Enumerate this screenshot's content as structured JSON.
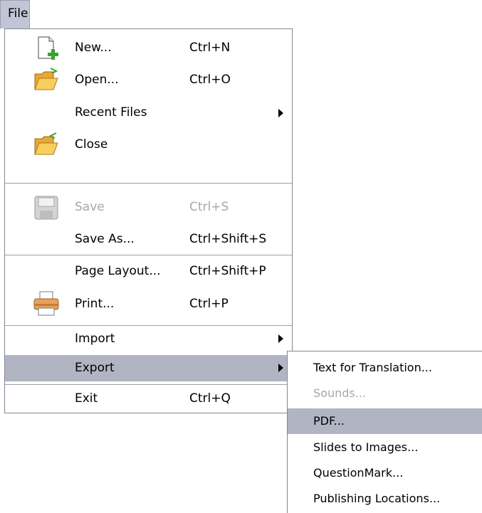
{
  "menubar": {
    "file_label": "File"
  },
  "menu": {
    "new": {
      "label": "New...",
      "shortcut": "Ctrl+N"
    },
    "open": {
      "label": "Open...",
      "shortcut": "Ctrl+O"
    },
    "recent_files": {
      "label": "Recent Files"
    },
    "close": {
      "label": "Close"
    },
    "save": {
      "label": "Save",
      "shortcut": "Ctrl+S"
    },
    "save_as": {
      "label": "Save As...",
      "shortcut": "Ctrl+Shift+S"
    },
    "page_layout": {
      "label": "Page Layout...",
      "shortcut": "Ctrl+Shift+P"
    },
    "print": {
      "label": "Print...",
      "shortcut": "Ctrl+P"
    },
    "import": {
      "label": "Import"
    },
    "export": {
      "label": "Export"
    },
    "exit": {
      "label": "Exit",
      "shortcut": "Ctrl+Q"
    }
  },
  "export_submenu": {
    "text_for_translation": "Text for Translation...",
    "sounds": "Sounds...",
    "pdf": "PDF...",
    "slides_to_images": "Slides to Images...",
    "questionmark": "QuestionMark...",
    "publishing_locations": "Publishing Locations..."
  },
  "colors": {
    "highlight": "#b0b4c3",
    "disabled_text": "#a7a7a7",
    "menubar_active": "#c1c6d6"
  },
  "icons": [
    "new-document-icon",
    "open-folder-icon",
    "close-folder-icon",
    "save-disk-icon",
    "printer-icon",
    "submenu-arrow-icon"
  ]
}
